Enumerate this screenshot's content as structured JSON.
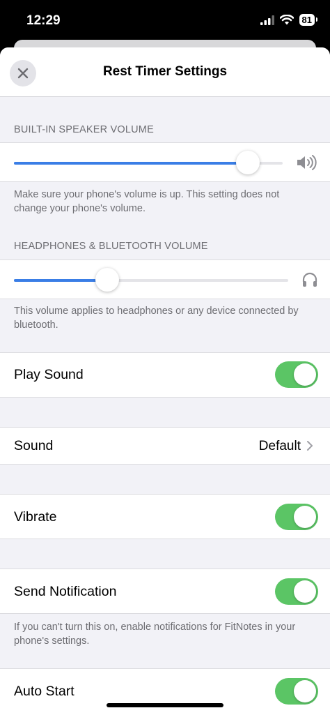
{
  "status_bar": {
    "time": "12:29",
    "battery": "81"
  },
  "header": {
    "title": "Rest Timer Settings"
  },
  "speaker": {
    "label": "BUILT-IN SPEAKER VOLUME",
    "level": 0.87,
    "note": "Make sure your phone's volume is up. This setting does not change your phone's volume."
  },
  "headphones": {
    "label": "HEADPHONES & BLUETOOTH VOLUME",
    "level": 0.34,
    "note": "This volume applies to headphones or any device connected by bluetooth."
  },
  "play_sound": {
    "label": "Play Sound",
    "on": true
  },
  "sound": {
    "label": "Sound",
    "value": "Default"
  },
  "vibrate": {
    "label": "Vibrate",
    "on": true
  },
  "notification": {
    "label": "Send Notification",
    "on": true,
    "note": "If you can't turn this on, enable notifications for FitNotes in your phone's settings."
  },
  "auto_start": {
    "label": "Auto Start",
    "on": true
  },
  "colors": {
    "accent": "#3a7ee6",
    "toggle_on": "#5bc565"
  },
  "icons": [
    "close-icon",
    "speaker-icon",
    "headphones-icon",
    "chevron-right-icon",
    "wifi-icon",
    "signal-icon",
    "battery-icon"
  ]
}
